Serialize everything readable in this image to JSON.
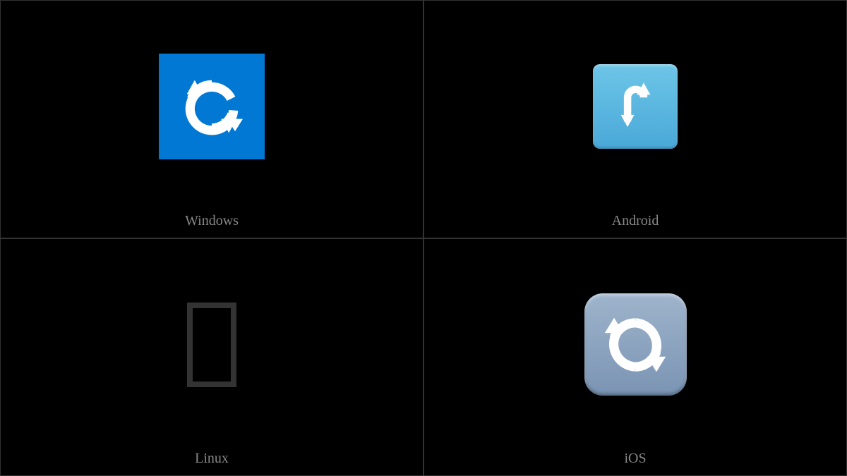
{
  "cells": [
    {
      "label": "Windows",
      "icon_name": "counterclockwise-arrows-windows"
    },
    {
      "label": "Android",
      "icon_name": "counterclockwise-arrows-android"
    },
    {
      "label": "Linux",
      "icon_name": "missing-glyph-linux"
    },
    {
      "label": "iOS",
      "icon_name": "counterclockwise-arrows-ios"
    }
  ]
}
